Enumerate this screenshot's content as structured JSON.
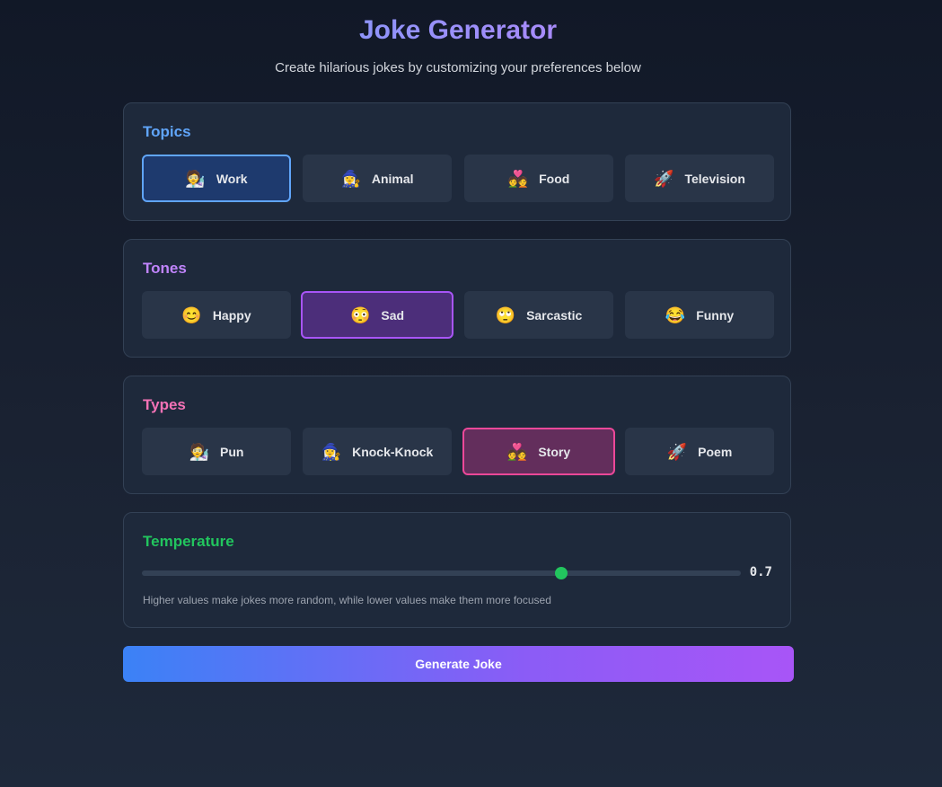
{
  "header": {
    "title": "Joke Generator",
    "subtitle": "Create hilarious jokes by customizing your preferences below"
  },
  "topics": {
    "title": "Topics",
    "title_color": "#60a5fa",
    "selected": "Work",
    "options": [
      {
        "label": "Work",
        "emoji": "🧑‍🔬",
        "icon": "scientist-icon"
      },
      {
        "label": "Animal",
        "emoji": "🧙‍♀️",
        "icon": "witch-icon"
      },
      {
        "label": "Food",
        "emoji": "💑",
        "icon": "couple-icon"
      },
      {
        "label": "Television",
        "emoji": "🚀",
        "icon": "rocket-icon"
      }
    ]
  },
  "tones": {
    "title": "Tones",
    "title_color": "#c084fc",
    "selected": "Sad",
    "options": [
      {
        "label": "Happy",
        "emoji": "😊",
        "icon": "smile-icon"
      },
      {
        "label": "Sad",
        "emoji": "😳",
        "icon": "flushed-icon"
      },
      {
        "label": "Sarcastic",
        "emoji": "🙄",
        "icon": "eye-roll-icon"
      },
      {
        "label": "Funny",
        "emoji": "😂",
        "icon": "laughing-icon"
      }
    ]
  },
  "types": {
    "title": "Types",
    "title_color": "#f472b6",
    "selected": "Story",
    "options": [
      {
        "label": "Pun",
        "emoji": "🧑‍🔬",
        "icon": "scientist-icon"
      },
      {
        "label": "Knock-Knock",
        "emoji": "🧙‍♀️",
        "icon": "witch-icon"
      },
      {
        "label": "Story",
        "emoji": "💑",
        "icon": "couple-icon"
      },
      {
        "label": "Poem",
        "emoji": "🚀",
        "icon": "rocket-icon"
      }
    ]
  },
  "temperature": {
    "title": "Temperature",
    "title_color": "#22c55e",
    "value": 0.7,
    "value_label": "0.7",
    "hint": "Higher values make jokes more random, while lower values make them more focused"
  },
  "generate": {
    "label": "Generate Joke"
  }
}
